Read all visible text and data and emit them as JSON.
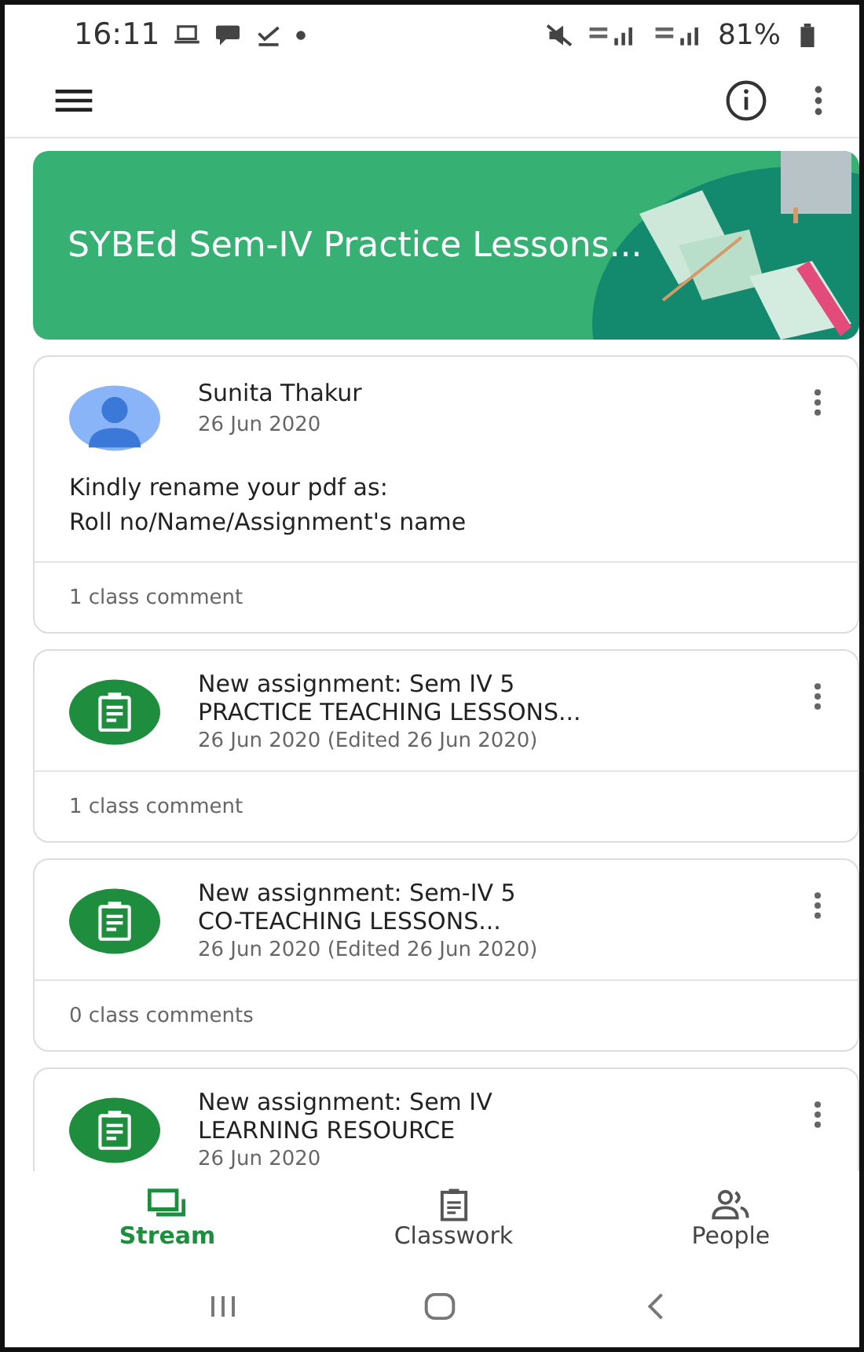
{
  "status_bar": {
    "time": "16:11",
    "battery": "81%"
  },
  "class_banner": {
    "title": "SYBEd Sem-IV  Practice Lessons..."
  },
  "posts": [
    {
      "kind": "announcement",
      "author": "Sunita Thakur",
      "date": "26 Jun 2020",
      "body": [
        "Kindly rename your pdf as:",
        "Roll no/Name/Assignment's name"
      ],
      "comments": "1 class comment"
    },
    {
      "kind": "assignment",
      "title": [
        "New assignment: Sem IV 5",
        "PRACTICE TEACHING LESSONS..."
      ],
      "date": "26 Jun 2020 (Edited 26 Jun 2020)",
      "comments": "1 class comment"
    },
    {
      "kind": "assignment",
      "title": [
        "New assignment: Sem-IV 5",
        "CO-TEACHING LESSONS..."
      ],
      "date": "26 Jun 2020 (Edited 26 Jun 2020)",
      "comments": "0 class comments"
    },
    {
      "kind": "assignment",
      "title": [
        "New assignment: Sem IV",
        "LEARNING RESOURCE"
      ],
      "date": "26 Jun 2020"
    }
  ],
  "bottom_nav": [
    {
      "kind": "stream",
      "label": "Stream",
      "selected": true
    },
    {
      "kind": "classwork",
      "label": "Classwork",
      "selected": false
    },
    {
      "kind": "people",
      "label": "People",
      "selected": false
    }
  ]
}
